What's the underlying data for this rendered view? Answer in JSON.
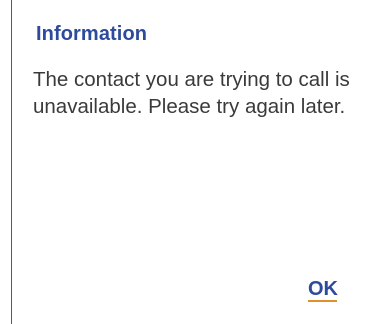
{
  "dialog": {
    "title": "Information",
    "message": "The contact you are trying to call is unavailable. Please try again later.",
    "ok_label": "OK"
  },
  "colors": {
    "title": "#2e4a9c",
    "text": "#3a3a3a",
    "button_underline": "#e0912b",
    "background": "#ffffff"
  }
}
